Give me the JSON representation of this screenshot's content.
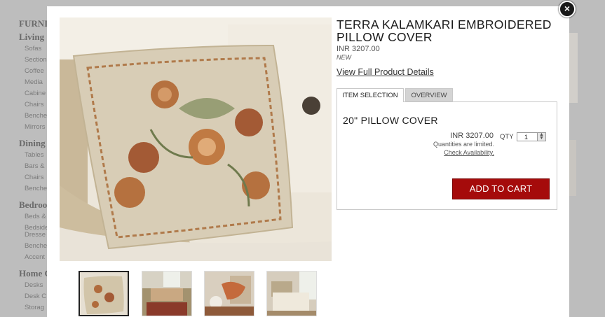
{
  "background": {
    "sections": [
      {
        "header": "FURNI",
        "items": []
      },
      {
        "header": "Living",
        "items": [
          "Sofas",
          "Section",
          "Coffee",
          "Media",
          "Cabine",
          "Chairs",
          "Benche",
          "Mirrors"
        ]
      },
      {
        "header": "Dining",
        "items": [
          "Tables",
          "Bars &",
          "Chairs",
          "Benche"
        ]
      },
      {
        "header": "Bedroo",
        "items": [
          "Beds &",
          "Bedside",
          "Dresse",
          "Benche",
          "Accent"
        ]
      },
      {
        "header": "Home C",
        "items": [
          "Desks",
          "Desk C",
          "Storag"
        ]
      }
    ]
  },
  "modal": {
    "close_icon": "×",
    "title": "TERRA KALAMKARI EMBROIDERED PILLOW COVER",
    "price": "INR 3207.00",
    "badge": "NEW",
    "details_link": "View Full Product Details",
    "tabs": [
      {
        "label": "ITEM SELECTION",
        "active": true
      },
      {
        "label": "OVERVIEW",
        "active": false
      }
    ],
    "item": {
      "name": "20\" PILLOW COVER",
      "price": "INR 3207.00",
      "qty_label": "QTY",
      "qty_value": "1",
      "limited_text": "Quantities are limited.",
      "availability_link": "Check Availability.",
      "add_to_cart": "ADD TO CART"
    },
    "thumbnails": [
      "pillow-closeup",
      "living-room",
      "accent-chair",
      "bedroom"
    ],
    "colors": {
      "cart_button": "#a50b0b",
      "tab_inactive": "#d4d4d4"
    }
  }
}
